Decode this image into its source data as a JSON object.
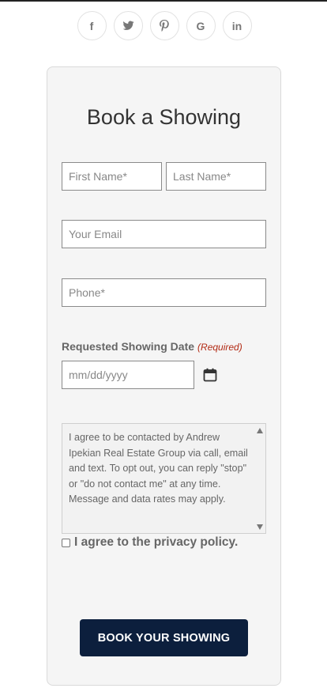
{
  "social": {
    "icons": [
      "facebook-icon",
      "twitter-icon",
      "pinterest-icon",
      "google-icon",
      "linkedin-icon"
    ],
    "labels": {
      "facebook": "f",
      "google": "G",
      "linkedin": "in"
    }
  },
  "form": {
    "title": "Book a Showing",
    "first_name_placeholder": "First Name*",
    "last_name_placeholder": "Last Name*",
    "email_placeholder": "Your Email",
    "phone_placeholder": "Phone*",
    "date_label": "Requested Showing Date",
    "date_required": "(Required)",
    "date_placeholder": "mm/dd/yyyy",
    "consent_text": "I agree to be contacted by Andrew Ipekian Real Estate Group via call, email and text. To opt out, you can reply \"stop\" or \"do not contact me\" at any time. Message and data rates may apply.",
    "privacy_label": "I agree to the privacy policy.",
    "submit_label": "BOOK YOUR SHOWING"
  },
  "colors": {
    "button": "#0c1f3d",
    "required": "#b22a14"
  }
}
